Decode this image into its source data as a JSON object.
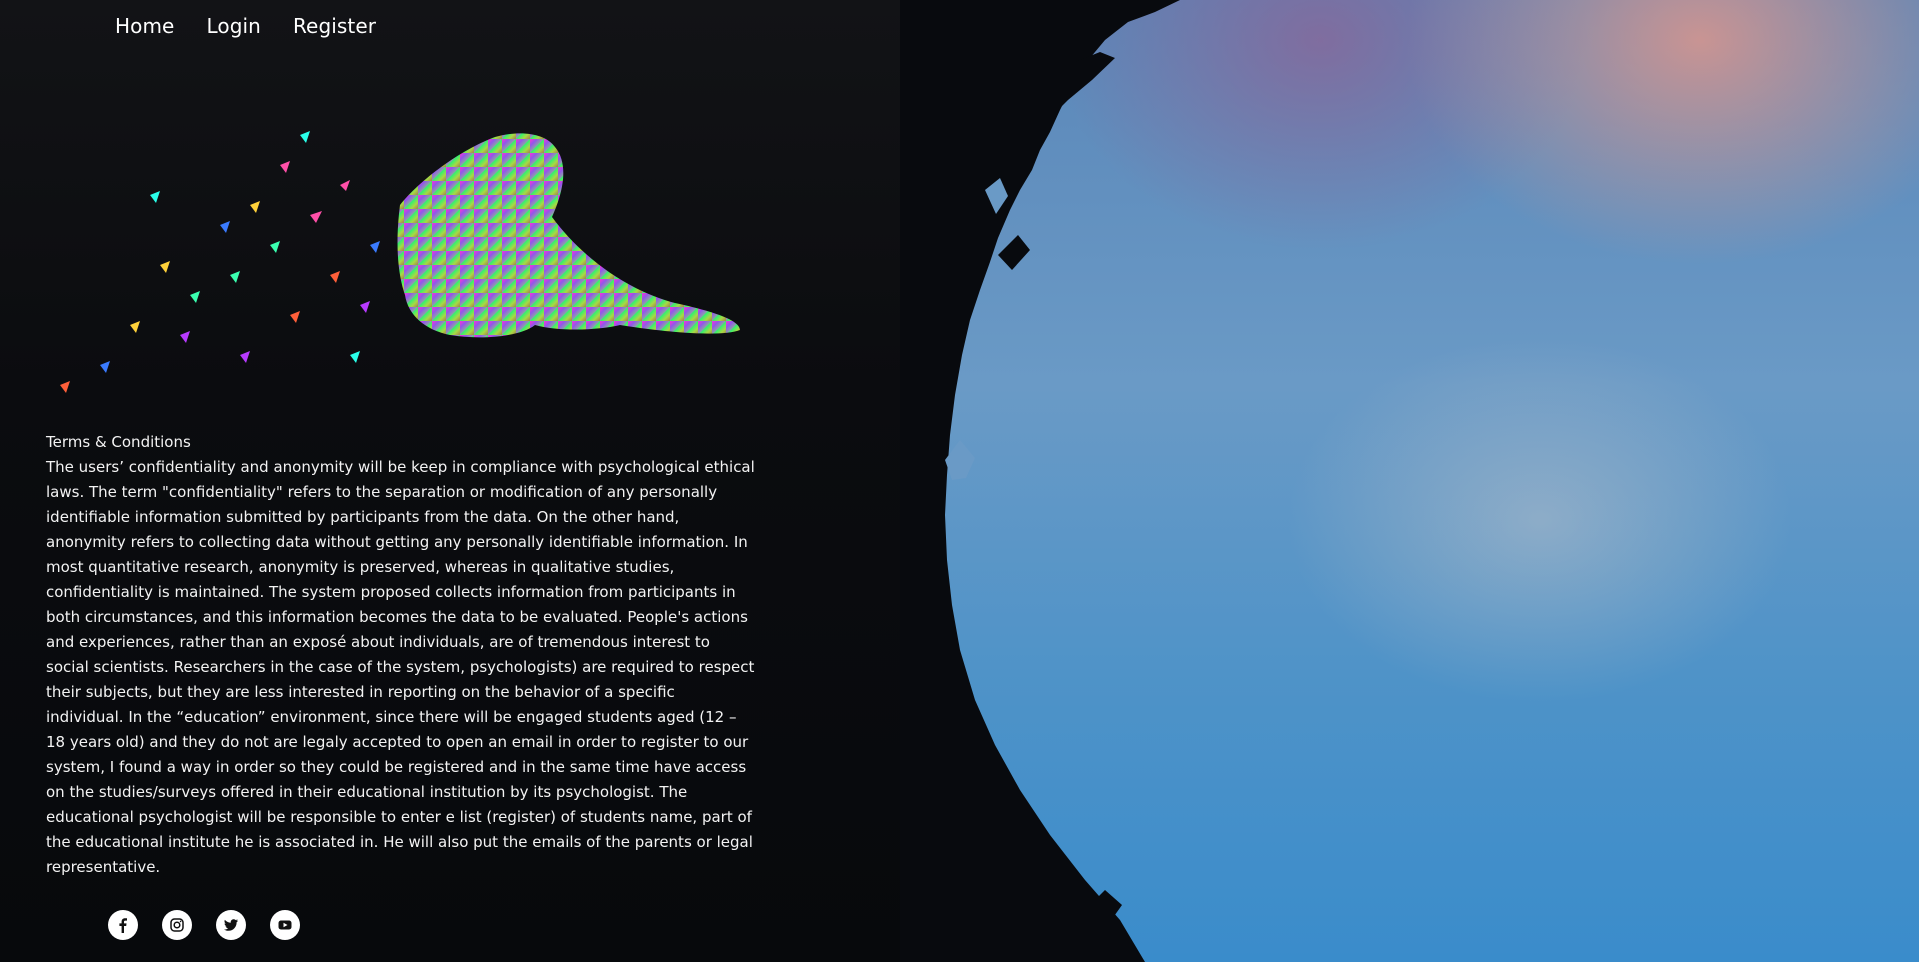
{
  "nav": {
    "items": [
      {
        "label": "Home"
      },
      {
        "label": "Login"
      },
      {
        "label": "Register"
      }
    ]
  },
  "hero": {
    "icon": "mosaic-sitting-person-illustration"
  },
  "terms": {
    "title": "Terms & Conditions",
    "body": "The users’ confidentiality and anonymity will be keep in compliance with psychological ethical laws. The term \"confidentiality\" refers to the separation or modification of any personally identifiable information submitted by participants from the data. On the other hand, anonymity refers to collecting data without getting any personally identifiable information. In most quantitative research, anonymity is preserved, whereas in qualitative studies, confidentiality is maintained. The system proposed collects information from participants in both circumstances, and this information becomes the data to be evaluated. People's actions and experiences, rather than an exposé about individuals, are of tremendous interest to social scientists. Researchers in the case of the system, psychologists) are required to respect their subjects, but they are less interested in reporting on the behavior of a specific individual. In the “education” environment, since there will be engaged students aged (12 – 18 years old) and they do not are legaly accepted to open an email in order to register to our system, I found a way in order so they could be registered and in the same time have access on the studies/surveys offered in their educational institution by its psychologist. The educational psychologist will be responsible to enter e list (register) of students name, part of the educational institute he is associated in. He will also put the emails of the parents or legal representative."
  },
  "social": [
    {
      "icon": "facebook-icon"
    },
    {
      "icon": "instagram-icon"
    },
    {
      "icon": "twitter-icon"
    },
    {
      "icon": "youtube-icon"
    }
  ],
  "colors": {
    "background": "#0a0b0e",
    "sky_blue": "#3a8ccb",
    "sky_pink": "#dc968c",
    "text": "#f3f3f3"
  }
}
